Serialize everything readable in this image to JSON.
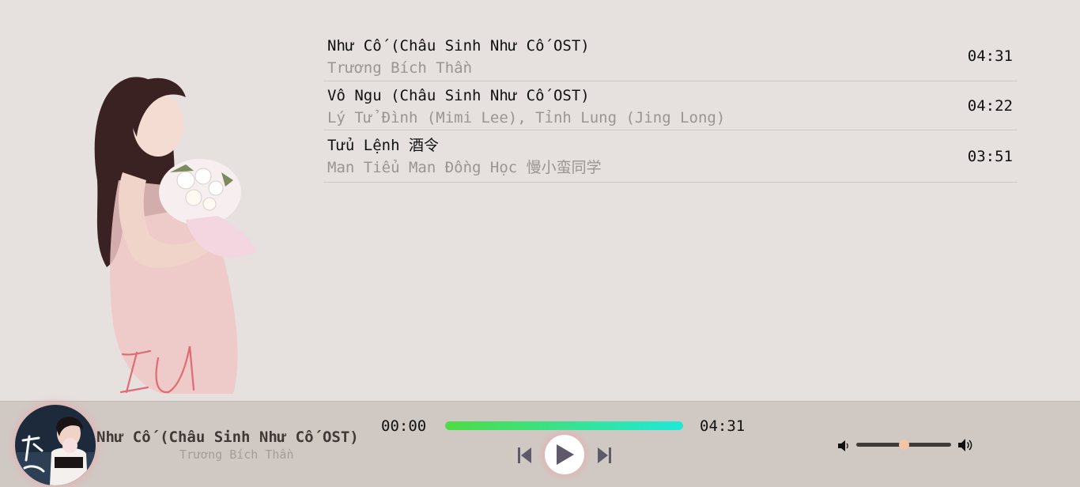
{
  "playlist": [
    {
      "title": "Như Cố (Châu Sinh Như Cố OST)",
      "artist": "Trương Bích Thần",
      "duration": "04:31"
    },
    {
      "title": "Vô Ngu (Châu Sinh Như Cố OST)",
      "artist": "Lý Tử Đình (Mimi Lee), Tỉnh Lung (Jing Long)",
      "duration": "04:22"
    },
    {
      "title": "Tửu Lệnh 酒令",
      "artist": "Man Tiểu Man Đồng Học 慢小蛮同学",
      "duration": "03:51"
    }
  ],
  "artwork": {
    "signature": "IU"
  },
  "player": {
    "title": "Như Cố (Châu Sinh Như Cố OST)",
    "artist": "Trương Bích Thần",
    "current_time": "00:00",
    "total_time": "04:31",
    "progress": 1.0,
    "volume": 0.5,
    "icons": {
      "prev": "skip-previous-icon",
      "play": "play-icon",
      "next": "skip-next-icon",
      "vol_low": "volume-low-icon",
      "vol_high": "volume-high-icon"
    },
    "colors": {
      "progress_start": "#4fdc44",
      "progress_end": "#1fe8d8",
      "glow": "#ebaaaf"
    }
  }
}
